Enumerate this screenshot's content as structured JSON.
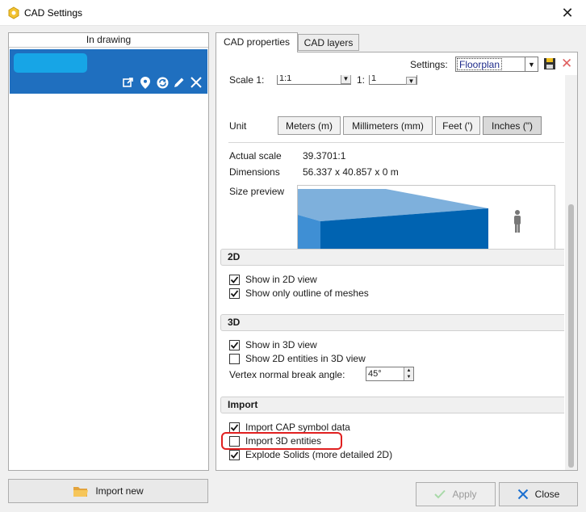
{
  "window": {
    "title": "CAD Settings",
    "close": "✕"
  },
  "left_panel": {
    "header": "In drawing"
  },
  "tabs": [
    {
      "label": "CAD properties",
      "active": true
    },
    {
      "label": "CAD layers",
      "active": false
    }
  ],
  "settings": {
    "label": "Settings:",
    "selected": "Floorplan"
  },
  "scale": {
    "label": "Scale 1:",
    "value1": "1:1",
    "label2": "1:",
    "value2": "1"
  },
  "unit": {
    "label": "Unit",
    "options": [
      "Meters (m)",
      "Millimeters (mm)",
      "Feet (')",
      "Inches (\")"
    ],
    "selected": "Inches (\")"
  },
  "actual_scale": {
    "label": "Actual scale",
    "value": "39.3701:1"
  },
  "dimensions": {
    "label": "Dimensions",
    "value": "56.337 x 40.857 x 0 m"
  },
  "size_preview": {
    "label": "Size preview"
  },
  "section_2d": {
    "title": "2D",
    "options": [
      {
        "label": "Show in 2D view",
        "checked": true
      },
      {
        "label": "Show only outline of meshes",
        "checked": true
      }
    ]
  },
  "section_3d": {
    "title": "3D",
    "options": [
      {
        "label": "Show in 3D view",
        "checked": true
      },
      {
        "label": "Show 2D entities in 3D view",
        "checked": false
      }
    ],
    "vertex_label": "Vertex normal break angle:",
    "vertex_value": "45°"
  },
  "section_import": {
    "title": "Import",
    "options": [
      {
        "label": "Import CAP symbol data",
        "checked": true
      },
      {
        "label": "Import 3D entities",
        "checked": false
      },
      {
        "label": "Explode Solids (more detailed 2D)",
        "checked": true
      }
    ]
  },
  "buttons": {
    "import_new": "Import new",
    "apply": "Apply",
    "close": "Close"
  },
  "colors": {
    "accent": "#1f6fbf",
    "highlight": "#e02020",
    "preview_blue": "#0063b1"
  }
}
